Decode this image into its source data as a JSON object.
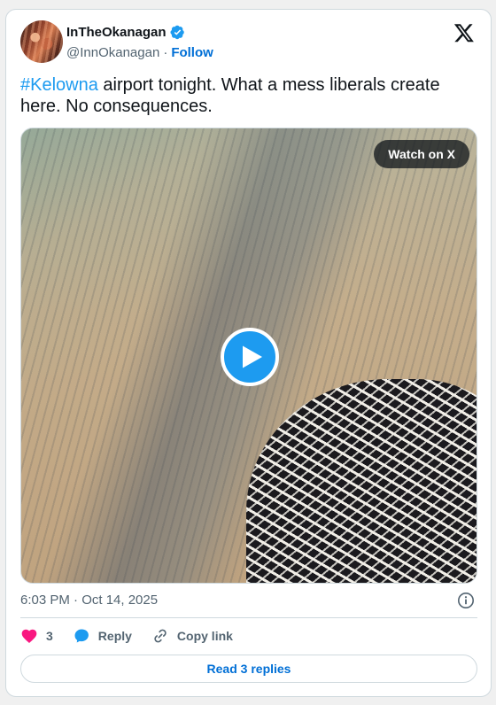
{
  "author": {
    "name": "InTheOkanagan",
    "handle": "@InnOkanagan",
    "separator": "·",
    "follow_label": "Follow",
    "verified": true
  },
  "tweet": {
    "hashtag": "#Kelowna",
    "text": " airport tonight. What a mess liberals create here. No consequences."
  },
  "media": {
    "watch_label": "Watch on X",
    "play_icon": "play-icon"
  },
  "meta": {
    "timestamp": "6:03 PM · Oct 14, 2025"
  },
  "actions": {
    "like_count": "3",
    "reply_label": "Reply",
    "copy_label": "Copy link"
  },
  "read_replies_label": "Read 3 replies",
  "colors": {
    "accent": "#1d9bf0",
    "link": "#006fd6",
    "like": "#f91880"
  }
}
